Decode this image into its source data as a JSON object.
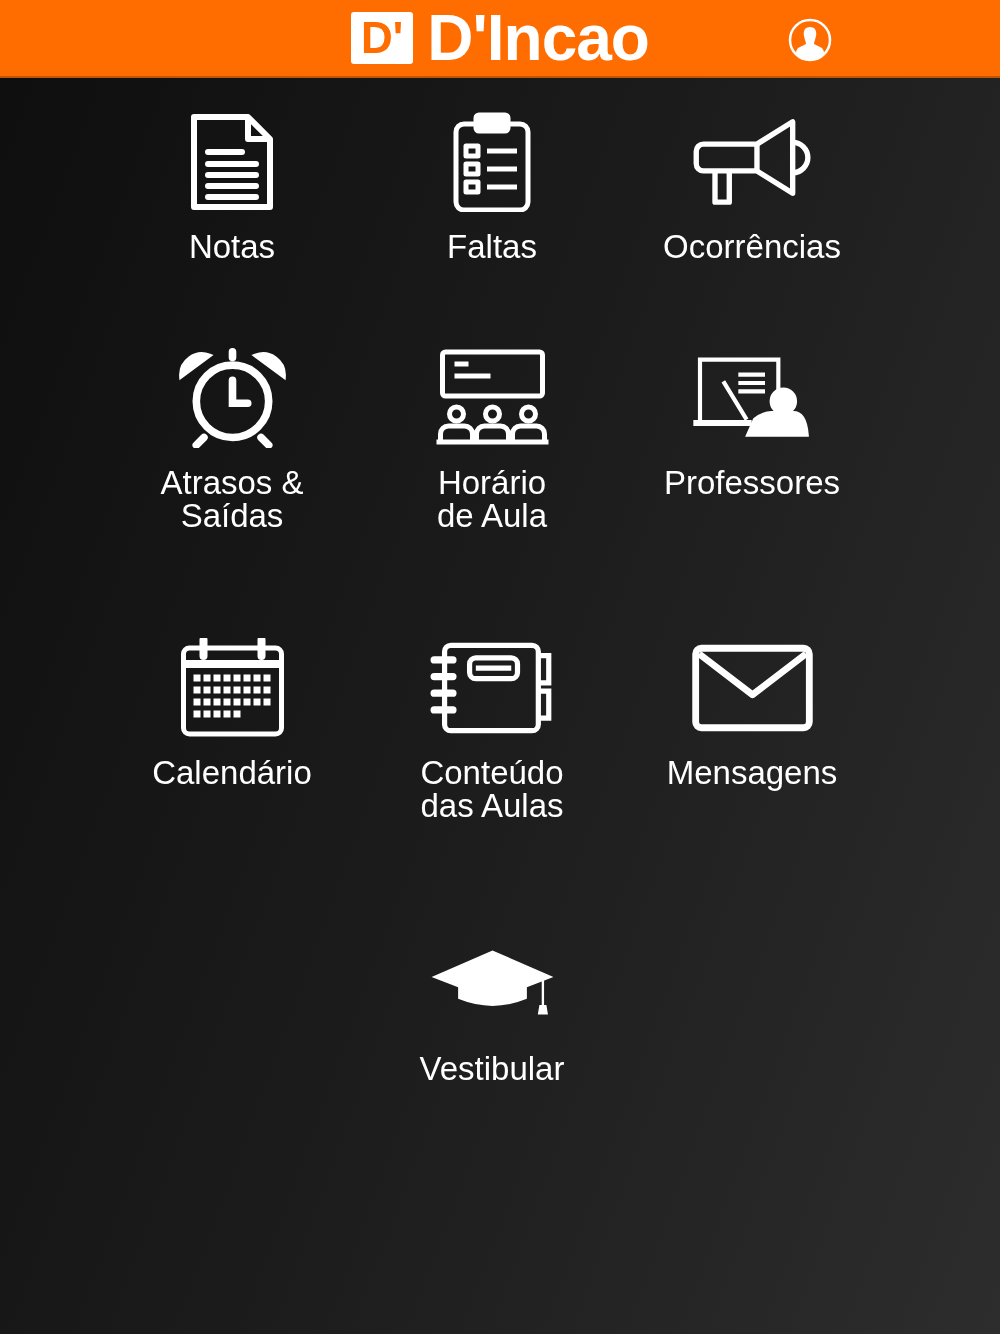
{
  "header": {
    "logo_mark": "D'",
    "brand": "D'Incao"
  },
  "menu": [
    {
      "label": "Notas",
      "kind": "document"
    },
    {
      "label": "Faltas",
      "kind": "clipboard"
    },
    {
      "label": "Ocorrências",
      "kind": "megaphone"
    },
    {
      "label": "Atrasos &\nSaídas",
      "kind": "alarm"
    },
    {
      "label": "Horário\nde Aula",
      "kind": "schedule"
    },
    {
      "label": "Professores",
      "kind": "teacher"
    },
    {
      "label": "Calendário",
      "kind": "calendar"
    },
    {
      "label": "Conteúdo\ndas Aulas",
      "kind": "notebook"
    },
    {
      "label": "Mensagens",
      "kind": "envelope"
    },
    {
      "label": "Vestibular",
      "kind": "cap"
    }
  ]
}
